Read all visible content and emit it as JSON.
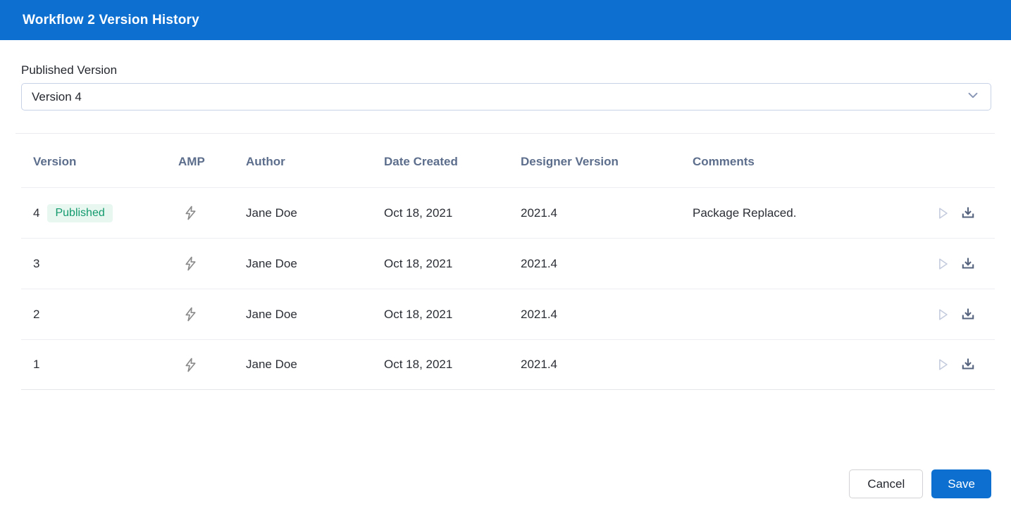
{
  "header": {
    "title": "Workflow 2 Version History"
  },
  "published_version": {
    "label": "Published Version",
    "selected_value": "Version 4"
  },
  "table": {
    "columns": {
      "version": "Version",
      "amp": "AMP",
      "author": "Author",
      "date_created": "Date Created",
      "designer_version": "Designer Version",
      "comments": "Comments"
    },
    "rows": [
      {
        "version": "4",
        "badge": "Published",
        "amp_icon": "lightning-icon",
        "author": "Jane Doe",
        "date_created": "Oct 18, 2021",
        "designer_version": "2021.4",
        "comments": "Package Replaced."
      },
      {
        "version": "3",
        "badge": "",
        "amp_icon": "lightning-icon",
        "author": "Jane Doe",
        "date_created": "Oct 18, 2021",
        "designer_version": "2021.4",
        "comments": ""
      },
      {
        "version": "2",
        "badge": "",
        "amp_icon": "lightning-icon",
        "author": "Jane Doe",
        "date_created": "Oct 18, 2021",
        "designer_version": "2021.4",
        "comments": ""
      },
      {
        "version": "1",
        "badge": "",
        "amp_icon": "lightning-icon",
        "author": "Jane Doe",
        "date_created": "Oct 18, 2021",
        "designer_version": "2021.4",
        "comments": ""
      }
    ],
    "row_action_icons": [
      "play-icon",
      "download-icon"
    ]
  },
  "footer": {
    "cancel_label": "Cancel",
    "save_label": "Save"
  },
  "colors": {
    "accent_blue": "#0d70d1",
    "badge_green_text": "#129a6d",
    "badge_green_bg": "#e9f7f1",
    "header_text": "#5c6e8c",
    "divider": "#eceef2",
    "amp_icon_gray": "#8a8a8a",
    "play_icon_muted": "#c3cbdd",
    "download_icon": "#56637e"
  }
}
